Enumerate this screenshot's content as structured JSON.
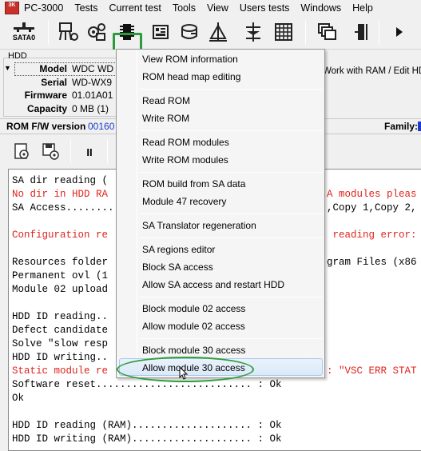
{
  "app": {
    "icon_text": "3K"
  },
  "menubar": {
    "items": [
      "PC-3000",
      "Tests",
      "Current test",
      "Tools",
      "View",
      "Users tests",
      "Windows",
      "Help"
    ]
  },
  "toolbar": {
    "sata_label": "SATA0",
    "icons": [
      "sata-port-icon",
      "drive-tree-icon",
      "gears-icon",
      "chip-icon",
      "ram-module-icon",
      "disk-drive-icon",
      "tower-icon",
      "tree-icon",
      "grid-icon",
      "windows-stack-icon",
      "door-exit-icon",
      "play-icon"
    ]
  },
  "hdd": {
    "group_label": "HDD",
    "model_label": "Model",
    "model_value": "WDC WD",
    "serial_label": "Serial",
    "serial_value": "WD-WX9",
    "firmware_label": "Firmware",
    "firmware_value": "01.01A01",
    "capacity_label": "Capacity",
    "capacity_value": "0 MB (1)",
    "work_ram_text": "Work with RAM / Edit HDD"
  },
  "fw": {
    "label": "ROM F/W version",
    "value": "00160",
    "family_label": "Family:"
  },
  "sub_toolbar": {
    "pause_label": "II"
  },
  "log": {
    "lines": [
      {
        "text": "SA dir reading (",
        "color": "black"
      },
      {
        "text": "No dir in HDD RA",
        "color": "red"
      },
      {
        "text": "SA Access........",
        "color": "black"
      },
      {
        "text": "",
        "color": "black"
      },
      {
        "text": "Configuration re",
        "color": "red"
      },
      {
        "text": "",
        "color": "black"
      },
      {
        "text": "Resources folder",
        "color": "black"
      },
      {
        "text": "Permanent ovl (1",
        "color": "black"
      },
      {
        "text": "Module 02 upload",
        "color": "black"
      },
      {
        "text": "",
        "color": "black"
      },
      {
        "text": "HDD ID reading..",
        "color": "black"
      },
      {
        "text": "Defect candidate",
        "color": "black"
      },
      {
        "text": "Solve \"slow resp",
        "color": "black"
      },
      {
        "text": "HDD ID writing..",
        "color": "black"
      },
      {
        "text": "Static module re",
        "color": "red"
      },
      {
        "text": "Software reset.......................... : Ok",
        "color": "black"
      },
      {
        "text": "Ok",
        "color": "black"
      },
      {
        "text": "",
        "color": "black"
      },
      {
        "text": "HDD ID reading (RAM).................... : Ok",
        "color": "black"
      },
      {
        "text": "HDD ID writing (RAM).................... : Ok",
        "color": "black"
      }
    ],
    "right_fragments": [
      {
        "text": "A modules pleas",
        "color": "red"
      },
      {
        "text": ",Copy 1,Copy 2,",
        "color": "black"
      },
      {
        "text": " reading error:",
        "color": "red"
      },
      {
        "text": "gram Files (x86",
        "color": "black"
      },
      {
        "text": ": \"VSC ERR STAT",
        "color": "red"
      }
    ]
  },
  "dropdown": {
    "items": [
      "View ROM information",
      "ROM head map editing",
      "Read ROM",
      "Write ROM",
      "Read ROM modules",
      "Write ROM modules",
      "ROM build from SA data",
      "Module 47 recovery",
      "SA Translator regeneration",
      "SA regions editor",
      "Block SA access",
      "Allow SA access and restart HDD",
      "Block module 02 access",
      "Allow module 02 access",
      "Block module 30 access",
      "Allow module 30 access"
    ],
    "hovered_item": "Allow module 30 access"
  },
  "colors": {
    "highlight_green": "#2e9a3e",
    "error_red": "#e0231c",
    "link_blue": "#1a3cc9"
  }
}
